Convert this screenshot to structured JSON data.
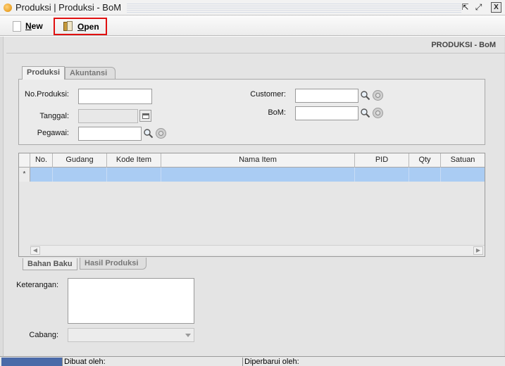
{
  "window": {
    "title": "Produksi | Produksi - BoM",
    "restore_glyph": "⇱",
    "maximize_glyph": "⤢",
    "close_glyph": "X"
  },
  "toolbar": {
    "new_label": "New",
    "new_accel": "N",
    "new_rest": "ew",
    "open_label": "Open",
    "open_accel": "O",
    "open_rest": "pen"
  },
  "form": {
    "title": "PRODUKSI - BoM",
    "tabs": [
      "Produksi",
      "Akuntansi"
    ],
    "fields": {
      "no_produksi": {
        "label": "No.Produksi:",
        "value": ""
      },
      "tanggal": {
        "label": "Tanggal:",
        "value": ""
      },
      "pegawai": {
        "label": "Pegawai:",
        "value": ""
      },
      "customer": {
        "label": "Customer:",
        "value": ""
      },
      "bom": {
        "label": "BoM:",
        "value": ""
      }
    }
  },
  "grid": {
    "columns": [
      "No.",
      "Gudang",
      "Kode Item",
      "Nama Item",
      "PID",
      "Qty",
      "Satuan"
    ],
    "new_row_marker": "*"
  },
  "bottom_tabs": [
    "Bahan Baku",
    "Hasil Produksi"
  ],
  "keterangan": {
    "label": "Keterangan:",
    "value": ""
  },
  "cabang": {
    "label": "Cabang:",
    "value": ""
  },
  "status": {
    "dibuat": "Dibuat oleh:",
    "diperbarui": "Diperbarui oleh:"
  }
}
